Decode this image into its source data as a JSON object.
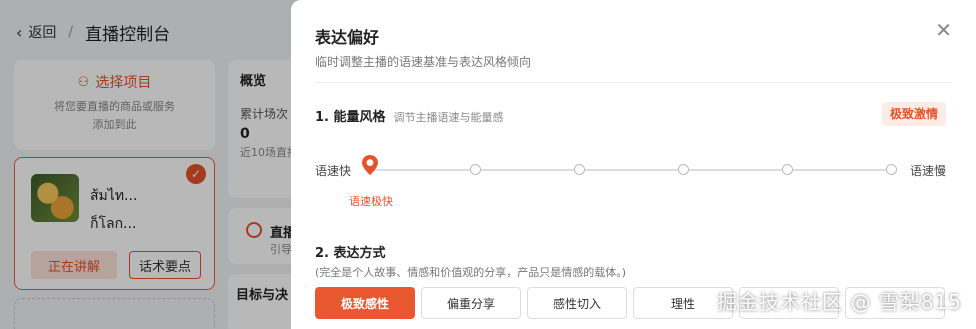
{
  "header": {
    "back_label": "返回",
    "separator": "/",
    "title": "直播控制台"
  },
  "select_card": {
    "label": "选择项目",
    "hint_line1": "将您要直播的商品或服务",
    "hint_line2": "添加到此"
  },
  "product": {
    "name_line1": "ส้มไท...",
    "name_line2": "ก็โลก...",
    "explaining_label": "正在讲解",
    "points_label": "话术要点"
  },
  "overview": {
    "title": "概览",
    "metric_label": "累计场次",
    "metric_value": "0",
    "metric_sub": "近10场直播"
  },
  "live_card": {
    "title": "直播",
    "sub": "引导"
  },
  "goal_card": {
    "title": "目标与决"
  },
  "drawer": {
    "title": "表达偏好",
    "subtitle": "临时调整主播的语速基准与表达风格倾向",
    "close_icon": "close-icon",
    "section1": {
      "title": "1. 能量风格",
      "hint": "调节主播语速与能量感",
      "current_tag": "极致激情",
      "left_label": "语速快",
      "right_label": "语速慢",
      "selected_label": "语速极快",
      "stops": 6,
      "selected_index": 0
    },
    "section2": {
      "title": "2. 表达方式",
      "hint": "(完全是个人故事、情感和价值观的分享，产品只是情感的载体。)",
      "options": [
        "极致感性",
        "偏重分享",
        "感性切入",
        "理性",
        "",
        ""
      ],
      "selected_index": 0
    }
  },
  "watermark": "掘金技术社区 @ 雪梨815",
  "colors": {
    "accent": "#e5532a",
    "overlay": "rgba(0,0,0,0.28)"
  }
}
